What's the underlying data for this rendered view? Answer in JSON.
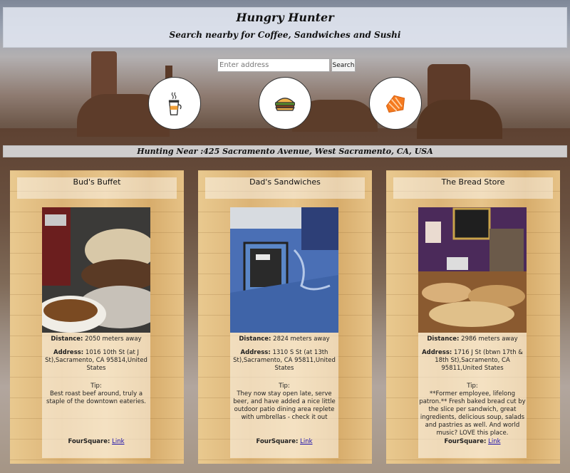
{
  "header": {
    "title": "Hungry Hunter",
    "subtitle": "Search nearby for Coffee, Sandwiches and Sushi"
  },
  "search": {
    "placeholder": "Enter address",
    "value": "",
    "button_label": "Search"
  },
  "categories": [
    {
      "name": "coffee",
      "icon": "coffee-cup-icon"
    },
    {
      "name": "sandwich",
      "icon": "burger-icon"
    },
    {
      "name": "sushi",
      "icon": "sushi-icon"
    }
  ],
  "location": {
    "label": "Hunting Near :",
    "address": "425 Sacramento Avenue, West Sacramento, CA, USA"
  },
  "cards": [
    {
      "title": "Bud's Buffet",
      "distance_label": "Distance:",
      "distance": "2050 meters away",
      "address_label": "Address:",
      "address": "1016 10th St (at J St),Sacramento, CA 95814,United States",
      "tip_label": "Tip:",
      "tip": "Best roast beef around, truly a staple of the downtown eateries.",
      "foursquare_label": "FourSquare:",
      "link_text": "Link"
    },
    {
      "title": "Dad's Sandwiches",
      "distance_label": "Distance:",
      "distance": "2824 meters away",
      "address_label": "Address:",
      "address": "1310 S St (at 13th St),Sacramento, CA 95811,United States",
      "tip_label": "Tip:",
      "tip": "They now stay open late, serve beer, and have added a nice little outdoor patio dining area replete with umbrellas - check it out",
      "foursquare_label": "FourSquare:",
      "link_text": "Link"
    },
    {
      "title": "The Bread Store",
      "distance_label": "Distance:",
      "distance": "2986 meters away",
      "address_label": "Address:",
      "address": "1716 J St (btwn 17th & 18th St),Sacramento, CA 95811,United States",
      "tip_label": "Tip:",
      "tip": "**Former employee, lifelong patron.** Fresh baked bread cut by the slice per sandwich, great ingredients, delicious soup, salads and pastries as well. And world music? LOVE this place.",
      "foursquare_label": "FourSquare:",
      "link_text": "Link"
    }
  ]
}
